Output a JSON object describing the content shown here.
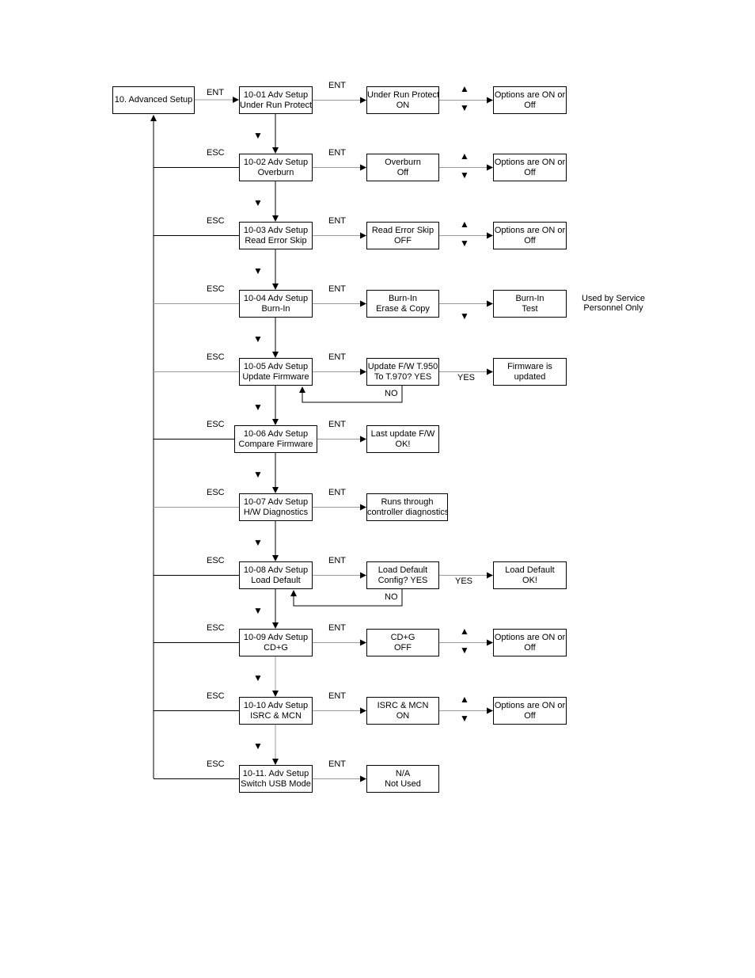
{
  "root": {
    "label": "10. Advanced Setup"
  },
  "labels": {
    "ent": "ENT",
    "esc": "ESC",
    "yes": "YES",
    "no": "NO"
  },
  "arrows": {
    "up": "▲",
    "down": "▼"
  },
  "steps": [
    {
      "code": "10-01 Adv Setup",
      "name": "Under Run Protect",
      "value_line1": "Under Run Protect",
      "value_line2": "ON",
      "result_line1": "Options are ON or",
      "result_line2": "Off",
      "mode": "toggle"
    },
    {
      "code": "10-02 Adv Setup",
      "name": "Overburn",
      "value_line1": "Overburn",
      "value_line2": "Off",
      "result_line1": "Options are ON or",
      "result_line2": "Off",
      "mode": "toggle"
    },
    {
      "code": "10-03 Adv Setup",
      "name": "Read Error Skip",
      "value_line1": "Read Error Skip",
      "value_line2": "OFF",
      "result_line1": "Options are ON or",
      "result_line2": "Off",
      "mode": "toggle"
    },
    {
      "code": "10-04 Adv Setup",
      "name": "Burn-In",
      "value_line1": "Burn-In",
      "value_line2": "Erase & Copy",
      "result_line1": "Burn-In",
      "result_line2": "Test",
      "mode": "down"
    },
    {
      "code": "10-05 Adv Setup",
      "name": "Update Firmware",
      "value_line1": "Update F/W T.950",
      "value_line2": "To T.970? YES",
      "result_line1": "Firmware is",
      "result_line2": "updated",
      "mode": "yesno"
    },
    {
      "code": "10-06 Adv Setup",
      "name": "Compare Firmware",
      "value_line1": "Last update F/W",
      "value_line2": "OK!",
      "mode": "none"
    },
    {
      "code": "10-07 Adv Setup",
      "name": "H/W Diagnostics",
      "value_line1": "Runs through",
      "value_line2": "controller diagnostics",
      "mode": "none"
    },
    {
      "code": "10-08 Adv Setup",
      "name": "Load Default",
      "value_line1": "Load Default",
      "value_line2": "Config? YES",
      "result_line1": "Load Default",
      "result_line2": "OK!",
      "mode": "yesno"
    },
    {
      "code": "10-09 Adv Setup",
      "name": "CD+G",
      "value_line1": "CD+G",
      "value_line2": "OFF",
      "result_line1": "Options are ON or",
      "result_line2": "Off",
      "mode": "toggle"
    },
    {
      "code": "10-10 Adv Setup",
      "name": "ISRC & MCN",
      "value_line1": "ISRC & MCN",
      "value_line2": "ON",
      "result_line1": "Options are ON or",
      "result_line2": "Off",
      "mode": "toggle"
    },
    {
      "code": "10-11. Adv Setup",
      "name": "Switch USB Mode",
      "value_line1": "N/A",
      "value_line2": "Not Used",
      "mode": "none"
    }
  ],
  "service_note": {
    "line1": "Used by Service",
    "line2": "Personnel Only"
  }
}
